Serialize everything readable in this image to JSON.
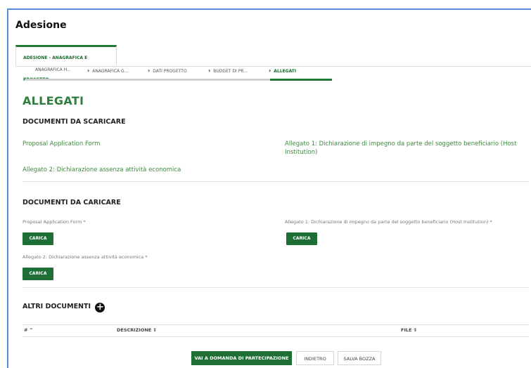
{
  "window": {
    "title": "Adesione"
  },
  "tabs": [
    {
      "label": "ADESIONE - ANAGRAFICA E PROGETTO"
    }
  ],
  "steps": [
    {
      "label": "ANAGRAFICA H..."
    },
    {
      "label": "ANAGRAFICA G..."
    },
    {
      "label": "DATI PROGETTO"
    },
    {
      "label": "BUDGET DI PR..."
    },
    {
      "label": "ALLEGATI"
    }
  ],
  "section_title": "ALLEGATI",
  "download": {
    "title": "DOCUMENTI DA SCARICARE",
    "links": [
      "Proposal Application Form",
      "Allegato 1: Dichiarazione di impegno da parte del soggetto beneficiario (Host Institution)",
      "Allegato 2: Dichiarazione assenza attività economica"
    ]
  },
  "upload": {
    "title": "DOCUMENTI DA CARICARE",
    "fields": [
      {
        "label": "Proposal Application Form *",
        "button": "CARICA"
      },
      {
        "label": "Allegato 1: Dichiarazione di impegno da parte del soggetto beneficiario (Host Institution) *",
        "button": "CARICA"
      },
      {
        "label": "Allegato 2: Dichiarazione assenza attività economica *",
        "button": "CARICA"
      }
    ]
  },
  "altri": {
    "title": "ALTRI DOCUMENTI",
    "add_icon": "plus-circle-icon",
    "columns": [
      "# ^",
      "DESCRIZIONE ⇕",
      "FILE ⇕"
    ]
  },
  "footer": {
    "primary": "VAI A DOMANDA DI PARTECIPAZIONE",
    "back": "INDIETRO",
    "save": "SALVA BOZZA"
  },
  "colors": {
    "accent": "#1f6e35",
    "link": "#3d8a3f",
    "frame": "#5a8fd8"
  }
}
